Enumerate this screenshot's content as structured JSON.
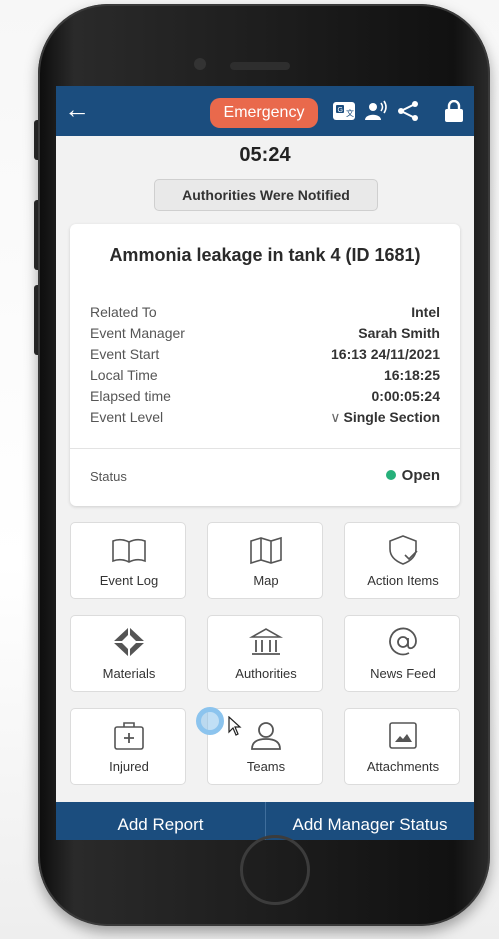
{
  "header": {
    "emergency_label": "Emergency",
    "icons": [
      "back-arrow-icon",
      "translate-icon",
      "voice-icon",
      "share-icon",
      "lock-icon"
    ]
  },
  "timer": "05:24",
  "notification": "Authorities Were Notified",
  "event": {
    "title": "Ammonia leakage in tank 4 (ID 1681)",
    "details": [
      {
        "label": "Related To",
        "value": "Intel"
      },
      {
        "label": "Event Manager",
        "value": "Sarah Smith"
      },
      {
        "label": "Event Start",
        "value": "16:13 24/11/2021"
      },
      {
        "label": "Local Time",
        "value": "16:18:25"
      },
      {
        "label": "Elapsed time",
        "value": "0:00:05:24"
      },
      {
        "label": "Event Level",
        "value": "Single Section"
      }
    ],
    "status_label": "Status",
    "status_value": "Open"
  },
  "tiles": [
    {
      "label": "Event Log",
      "icon": "book-icon"
    },
    {
      "label": "Map",
      "icon": "map-icon"
    },
    {
      "label": "Action Items",
      "icon": "shield-check-icon"
    },
    {
      "label": "Materials",
      "icon": "materials-icon"
    },
    {
      "label": "Authorities",
      "icon": "building-icon"
    },
    {
      "label": "News Feed",
      "icon": "at-icon"
    },
    {
      "label": "Injured",
      "icon": "first-aid-icon"
    },
    {
      "label": "Teams",
      "icon": "person-icon"
    },
    {
      "label": "Attachments",
      "icon": "image-icon"
    }
  ],
  "footer": {
    "add_report": "Add Report",
    "add_manager_status": "Add Manager Status"
  },
  "colors": {
    "header_bg": "#1b4d7e",
    "emergency": "#e9694c",
    "status_open": "#26b07a"
  }
}
